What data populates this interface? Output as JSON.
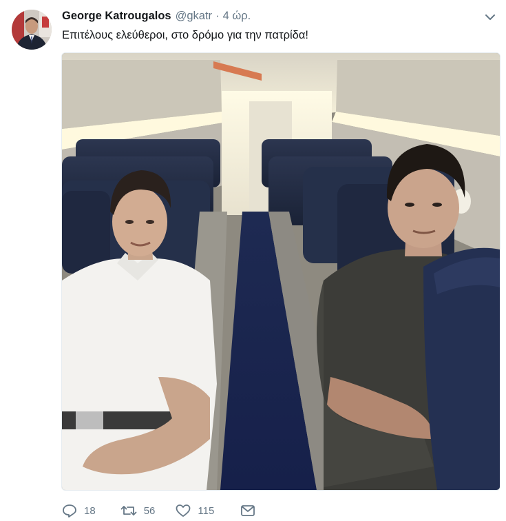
{
  "tweet": {
    "author": {
      "display_name": "George Katrougalos",
      "handle": "@gkatr"
    },
    "separator": "·",
    "timestamp": "4 ώρ.",
    "text": "Επιτέλους ελεύθεροι, στο δρόμο για την πατρίδα!",
    "actions": {
      "reply_count": "18",
      "retweet_count": "56",
      "like_count": "115"
    },
    "icons": {
      "reply": "reply-icon",
      "retweet": "retweet-icon",
      "like": "heart-icon",
      "message": "envelope-icon",
      "more": "chevron-down-icon"
    },
    "colors": {
      "text": "#14171a",
      "secondary": "#657786"
    }
  }
}
